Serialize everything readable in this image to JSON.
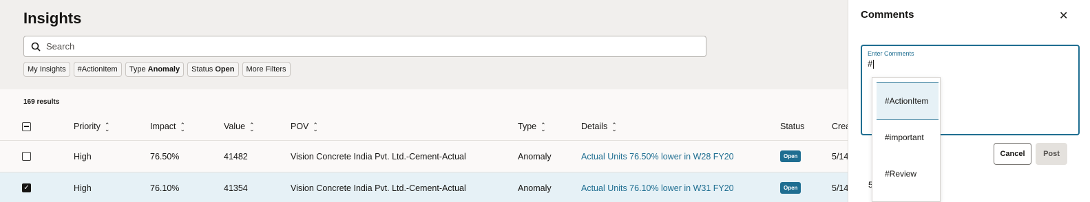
{
  "page": {
    "title": "Insights"
  },
  "search": {
    "placeholder": "Search"
  },
  "filters": [
    {
      "label": "My Insights"
    },
    {
      "label": "#ActionItem"
    },
    {
      "label_a": "Type ",
      "label_b": "Anomaly"
    },
    {
      "label_a": "Status ",
      "label_b": "Open"
    },
    {
      "label": "More Filters"
    }
  ],
  "results": {
    "count_text": "169 results"
  },
  "table": {
    "columns": [
      "Priority",
      "Impact",
      "Value",
      "POV",
      "Type",
      "Details",
      "Status",
      "Crea"
    ],
    "rows": [
      {
        "checked": false,
        "priority": "High",
        "impact": "76.50%",
        "value": "41482",
        "pov": "Vision Concrete India Pvt. Ltd.-Cement-Actual",
        "type": "Anomaly",
        "details": "Actual Units 76.50% lower in W28 FY20",
        "status": "Open",
        "created": "5/14"
      },
      {
        "checked": true,
        "priority": "High",
        "impact": "76.10%",
        "value": "41354",
        "pov": "Vision Concrete India Pvt. Ltd.-Cement-Actual",
        "type": "Anomaly",
        "details": "Actual Units 76.10% lower in W31 FY20",
        "status": "Open",
        "created": "5/14"
      }
    ]
  },
  "comments": {
    "title": "Comments",
    "field_label": "Enter Comments",
    "field_value": "#",
    "suggestions": [
      "#ActionItem",
      "#important",
      "#Review"
    ],
    "cancel_label": "Cancel",
    "post_label": "Post",
    "partial_text": "5"
  },
  "colors": {
    "accent": "#1f6e91",
    "selected_row": "#e6f1f6"
  }
}
